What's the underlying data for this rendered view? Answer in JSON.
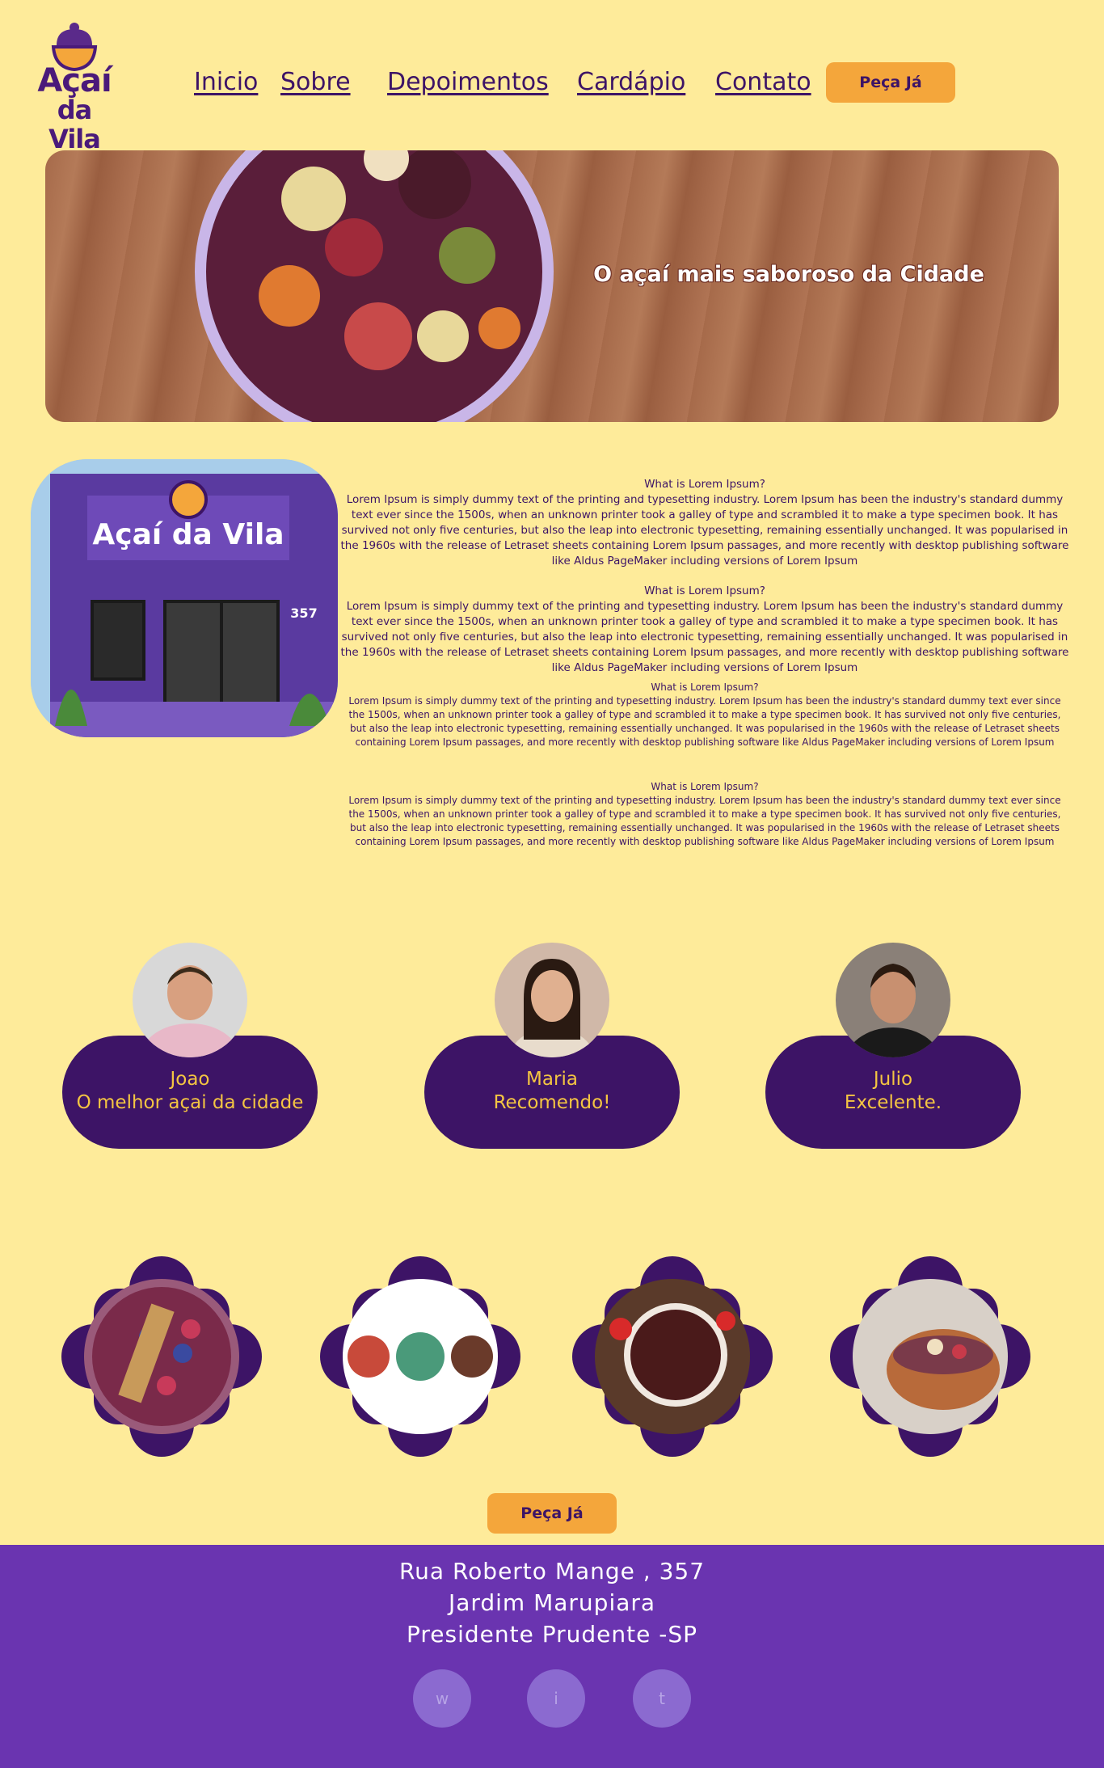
{
  "brand": {
    "logo_line1": "Açaí",
    "logo_line2": "da Vila"
  },
  "nav": {
    "items": [
      "Inicio",
      "Sobre",
      "Depoimentos",
      "Cardápio",
      "Contato"
    ],
    "order_label": "Peça Já"
  },
  "hero": {
    "title": "O açaí mais saboroso da Cidade"
  },
  "about": {
    "store_sign": "Açaí da Vila",
    "store_number": "357",
    "blocks": [
      {
        "heading": "What is Lorem Ipsum?",
        "text": "Lorem Ipsum is simply dummy text of the printing and typesetting industry. Lorem Ipsum has been the industry's standard dummy text ever since the 1500s, when an unknown printer took a galley of type and scrambled it to make a type specimen book. It has survived not only five centuries, but also the leap into electronic typesetting, remaining essentially unchanged. It was popularised in the 1960s with the release of Letraset sheets containing Lorem Ipsum passages, and more recently with desktop publishing software like Aldus PageMaker including versions of Lorem Ipsum"
      },
      {
        "heading": "What is Lorem Ipsum?",
        "text": "Lorem Ipsum is simply dummy text of the printing and typesetting industry. Lorem Ipsum has been the industry's standard dummy text ever since the 1500s, when an unknown printer took a galley of type and scrambled it to make a type specimen book. It has survived not only five centuries, but also the leap into electronic typesetting, remaining essentially unchanged. It was popularised in the 1960s with the release of Letraset sheets containing Lorem Ipsum passages, and more recently with desktop publishing software like Aldus PageMaker including versions of Lorem Ipsum"
      },
      {
        "heading": "What is Lorem Ipsum?",
        "text": "Lorem Ipsum is simply dummy text of the printing and typesetting industry. Lorem Ipsum has been the industry's standard dummy text ever since the 1500s, when an unknown printer took a galley of type and scrambled it to make a type specimen book. It has survived not only five centuries, but also the leap into electronic typesetting, remaining essentially unchanged. It was popularised in the 1960s with the release of Letraset sheets containing Lorem Ipsum passages, and more recently with desktop publishing software like Aldus PageMaker including versions of Lorem Ipsum"
      },
      {
        "heading": "What is Lorem Ipsum?",
        "text": "Lorem Ipsum is simply dummy text of the printing and typesetting industry. Lorem Ipsum has been the industry's standard dummy text ever since the 1500s, when an unknown printer took a galley of type and scrambled it to make a type specimen book. It has survived not only five centuries, but also the leap into electronic typesetting, remaining essentially unchanged. It was popularised in the 1960s with the release of Letraset sheets containing Lorem Ipsum passages, and more recently with desktop publishing software like Aldus PageMaker including versions of Lorem Ipsum"
      }
    ]
  },
  "testimonials": [
    {
      "name": "Joao",
      "quote": "O melhor açai da cidade"
    },
    {
      "name": "Maria",
      "quote": "Recomendo!"
    },
    {
      "name": "Julio",
      "quote": "Excelente."
    }
  ],
  "gallery_order_label": "Peça Já",
  "footer": {
    "address_line1": "Rua Roberto Mange , 357",
    "address_line2": "Jardim Marupiara",
    "address_line3": "Presidente Prudente -SP",
    "social": [
      "w",
      "i",
      "t"
    ]
  },
  "colors": {
    "background": "#feeb9a",
    "purple_dark": "#3d1466",
    "purple_footer": "#6a34b0",
    "accent": "#f4a63b",
    "quote_text": "#f4c542"
  }
}
